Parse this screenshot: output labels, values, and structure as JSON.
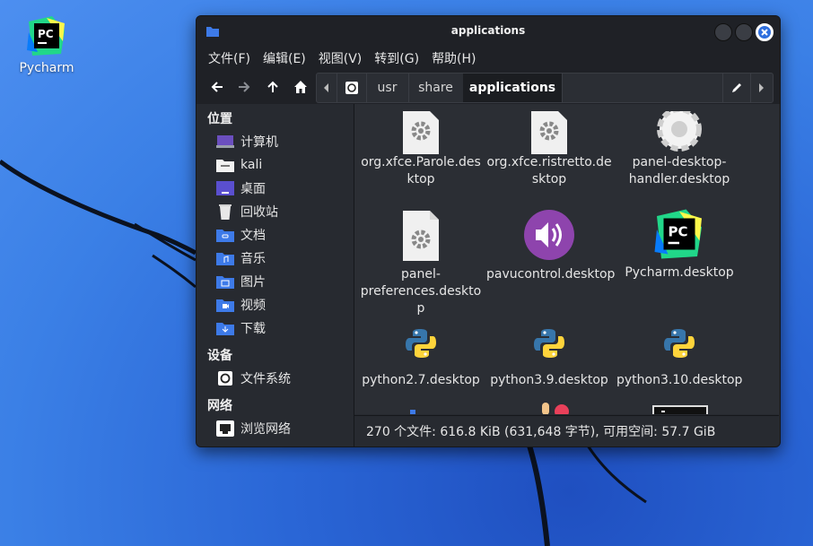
{
  "desktop": {
    "icons": [
      {
        "label": "Pycharm",
        "icon": "pycharm-icon"
      }
    ]
  },
  "window": {
    "title": "applications",
    "menu": [
      "文件(F)",
      "编辑(E)",
      "视图(V)",
      "转到(G)",
      "帮助(H)"
    ],
    "path": [
      "usr",
      "share",
      "applications"
    ],
    "sidebar": {
      "places_heading": "位置",
      "places": [
        "计算机",
        "kali",
        "桌面",
        "回收站",
        "文档",
        "音乐",
        "图片",
        "视频",
        "下载"
      ],
      "devices_heading": "设备",
      "devices": [
        "文件系统"
      ],
      "network_heading": "网络",
      "network": [
        "浏览网络"
      ]
    },
    "files": [
      {
        "name": "org.xfce.Parole.desktop",
        "lines": [
          "org.xfce.Parole.des",
          "ktop"
        ],
        "icon": "gear-file-icon"
      },
      {
        "name": "org.xfce.ristretto.desktop",
        "lines": [
          "org.xfce.ristretto.de",
          "sktop"
        ],
        "icon": "gear-file-icon"
      },
      {
        "name": "panel-desktop-handler.desktop",
        "lines": [
          "panel-desktop-",
          "handler.desktop"
        ],
        "icon": "settings-gear-icon"
      },
      {
        "name": "panel-preferences.desktop",
        "lines": [
          "panel-",
          "preferences.deskto",
          "p"
        ],
        "icon": "gear-file-icon"
      },
      {
        "name": "pavucontrol.desktop",
        "lines": [
          "pavucontrol.desktop"
        ],
        "icon": "volume-icon"
      },
      {
        "name": "Pycharm.desktop",
        "lines": [
          "Pycharm.desktop"
        ],
        "icon": "pycharm-icon"
      },
      {
        "name": "python2.7.desktop",
        "lines": [
          "python2.7.desktop"
        ],
        "icon": "python-icon"
      },
      {
        "name": "python3.9.desktop",
        "lines": [
          "python3.9.desktop"
        ],
        "icon": "python-icon"
      },
      {
        "name": "python3.10.desktop",
        "lines": [
          "python3.10.desktop"
        ],
        "icon": "python-icon"
      }
    ],
    "status": "270 个文件: 616.8 KiB (631,648 字节), 可用空间: 57.7 GiB"
  },
  "colors": {
    "accent": "#3d7ae8",
    "window_bg": "#272a30",
    "content_bg": "#2b2e34",
    "pycharm_green": "#21d789",
    "pavucontrol_purple": "#8e44ad"
  }
}
